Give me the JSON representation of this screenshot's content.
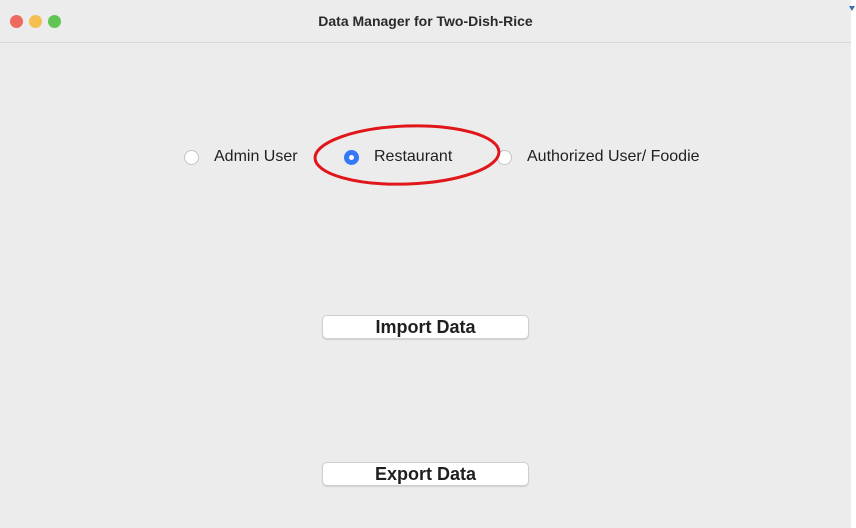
{
  "window": {
    "title": "Data Manager for Two-Dish-Rice",
    "controls": {
      "close_color": "#ed6a5e",
      "minimize_color": "#f5bf4f",
      "zoom_color": "#61c554"
    }
  },
  "user_type": {
    "options": [
      {
        "label": "Admin User",
        "selected": false
      },
      {
        "label": "Restaurant",
        "selected": true
      },
      {
        "label": "Authorized User/ Foodie",
        "selected": false
      }
    ],
    "accent_color": "#3478f6"
  },
  "actions": {
    "import_label": "Import Data",
    "export_label": "Export Data"
  },
  "annotation": {
    "shape": "ellipse",
    "color": "#e0161b",
    "target": "Restaurant"
  }
}
